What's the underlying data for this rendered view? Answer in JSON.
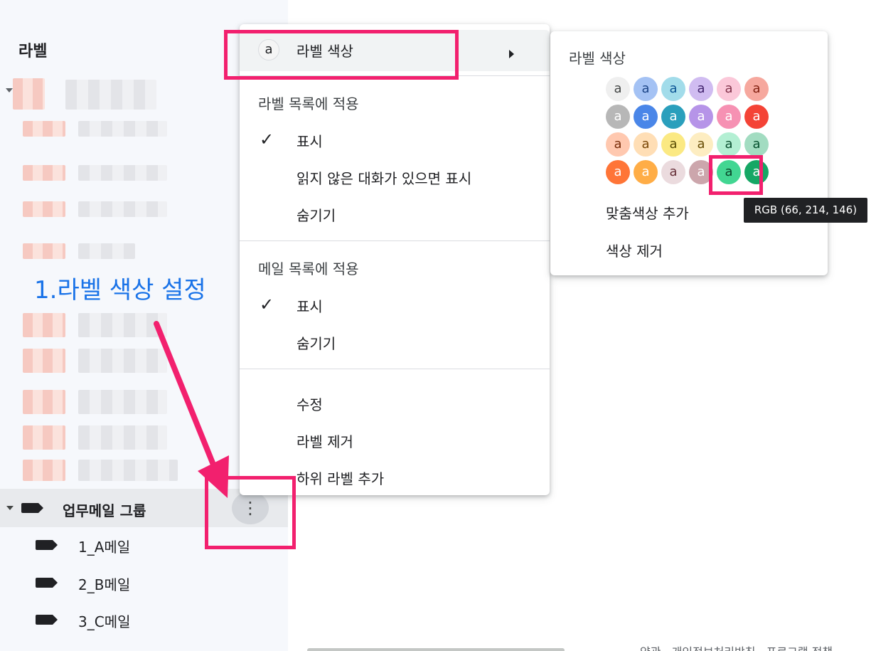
{
  "sidebar": {
    "title": "라벨",
    "group": {
      "name": "업무메일 그룹"
    },
    "children": [
      "1_A메일",
      "2_B메일",
      "3_C메일"
    ]
  },
  "annotation": {
    "text": "1.라벨 색상 설정"
  },
  "menu": {
    "color_label": "라벨 색상",
    "color_icon_text": "a",
    "section1_header": "라벨 목록에 적용",
    "section1_items": [
      "표시",
      "읽지 않은 대화가 있으면 표시",
      "숨기기"
    ],
    "section2_header": "메일 목록에 적용",
    "section2_items": [
      "표시",
      "숨기기"
    ],
    "actions": [
      "수정",
      "라벨 제거",
      "하위 라벨 추가"
    ],
    "checked_icon": "check-icon"
  },
  "submenu": {
    "title": "라벨 색상",
    "swatch_text": "a",
    "swatches": [
      [
        {
          "bg": "#efefef",
          "fg": "#444746"
        },
        {
          "bg": "#a4c2f4",
          "fg": "#1c4587"
        },
        {
          "bg": "#a2dcea",
          "fg": "#0b5394"
        },
        {
          "bg": "#d0bcf1",
          "fg": "#41236d"
        },
        {
          "bg": "#fbc8d9",
          "fg": "#83334c"
        },
        {
          "bg": "#f6a89e",
          "fg": "#822111"
        }
      ],
      [
        {
          "bg": "#b7b7b7",
          "fg": "#ffffff"
        },
        {
          "bg": "#4a86e8",
          "fg": "#ffffff"
        },
        {
          "bg": "#2a9fbc",
          "fg": "#ffffff"
        },
        {
          "bg": "#b694e8",
          "fg": "#ffffff"
        },
        {
          "bg": "#f691b3",
          "fg": "#ffffff"
        },
        {
          "bg": "#f44336",
          "fg": "#ffffff"
        }
      ],
      [
        {
          "bg": "#ffc8af",
          "fg": "#7a2e0b"
        },
        {
          "bg": "#ffdeb5",
          "fg": "#7a4706"
        },
        {
          "bg": "#fbe983",
          "fg": "#594c05"
        },
        {
          "bg": "#fdedc1",
          "fg": "#684e07"
        },
        {
          "bg": "#b3efd3",
          "fg": "#0b4f30"
        },
        {
          "bg": "#a2dcc1",
          "fg": "#04502e"
        }
      ],
      [
        {
          "bg": "#ff7537",
          "fg": "#ffffff"
        },
        {
          "bg": "#ffad46",
          "fg": "#ffffff"
        },
        {
          "bg": "#ebdbde",
          "fg": "#662e37"
        },
        {
          "bg": "#cca6ac",
          "fg": "#ffffff"
        },
        {
          "bg": "#42d692",
          "fg": "#094228"
        },
        {
          "bg": "#16a765",
          "fg": "#ffffff"
        }
      ]
    ],
    "add_custom": "맞춤색상 추가",
    "remove_color": "색상 제거"
  },
  "tooltip": {
    "text": "RGB (66, 214, 146)"
  },
  "footer": {
    "text": "약관 · 개인정보처리방침 · 프로그램 정책"
  },
  "colors": {
    "highlight": "#f2206e",
    "annotation": "#1a73e8"
  }
}
